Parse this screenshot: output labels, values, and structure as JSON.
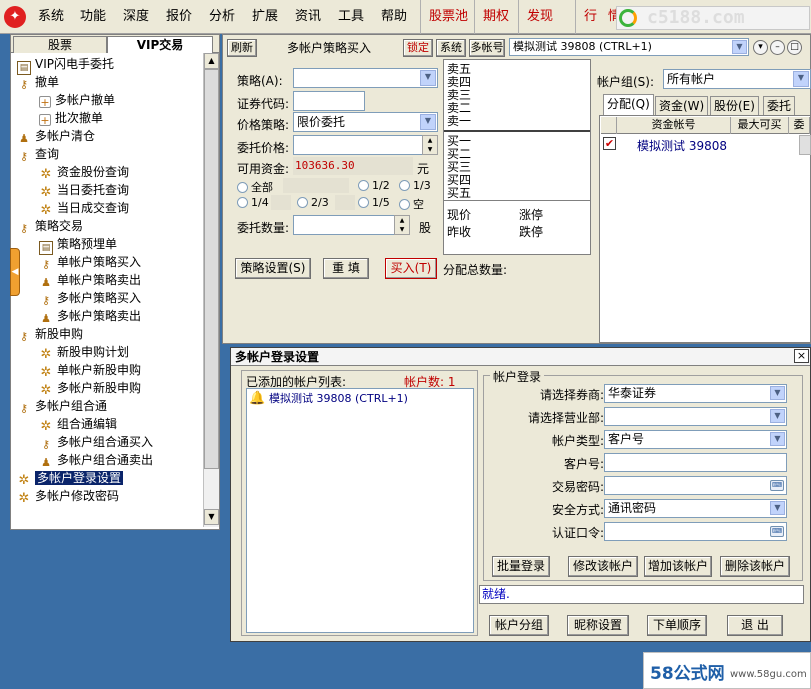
{
  "menubar": {
    "items": [
      "系统",
      "功能",
      "深度",
      "报价",
      "分析",
      "扩展",
      "资讯",
      "工具",
      "帮助"
    ],
    "red_items": [
      "股票池",
      "期权",
      "发现"
    ],
    "extra_items": [
      "行",
      "情"
    ],
    "brand": "c5188.com"
  },
  "left_panel": {
    "tabs": [
      "股票",
      "VIP交易"
    ],
    "tree": [
      {
        "label": "VIP闪电手委托",
        "icon": "book"
      },
      {
        "label": "撤单",
        "icon": "key"
      },
      {
        "label": "多帐户撤单",
        "icon": "plus"
      },
      {
        "label": "批次撤单",
        "icon": "plus"
      },
      {
        "label": "多帐户清仓",
        "icon": "person"
      },
      {
        "label": "查询",
        "icon": "key"
      },
      {
        "label": "资金股份查询",
        "icon": "gear"
      },
      {
        "label": "当日委托查询",
        "icon": "gear"
      },
      {
        "label": "当日成交查询",
        "icon": "gear"
      },
      {
        "label": "策略交易",
        "icon": "key"
      },
      {
        "label": "策略预埋单",
        "icon": "book"
      },
      {
        "label": "单帐户策略买入",
        "icon": "key"
      },
      {
        "label": "单帐户策略卖出",
        "icon": "person"
      },
      {
        "label": "多帐户策略买入",
        "icon": "key"
      },
      {
        "label": "多帐户策略卖出",
        "icon": "person"
      },
      {
        "label": "新股申购",
        "icon": "key"
      },
      {
        "label": "新股申购计划",
        "icon": "gear"
      },
      {
        "label": "单帐户新股申购",
        "icon": "gear"
      },
      {
        "label": "多帐户新股申购",
        "icon": "gear"
      },
      {
        "label": "多帐户组合通",
        "icon": "key"
      },
      {
        "label": "组合通编辑",
        "icon": "gear"
      },
      {
        "label": "多帐户组合通买入",
        "icon": "key"
      },
      {
        "label": "多帐户组合通卖出",
        "icon": "person"
      },
      {
        "label": "多帐户登录设置",
        "icon": "gear"
      },
      {
        "label": "多帐户修改密码",
        "icon": "gear"
      }
    ]
  },
  "main": {
    "refresh": "刷新",
    "title": "多帐户策略买入",
    "lock": "锁定",
    "system": "系统",
    "multi_account": "多帐号",
    "account_combo": "模拟测试 39808 (CTRL+1)",
    "labels": {
      "strategy": "策略(A):",
      "code": "证券代码:",
      "price_strategy": "价格策略:",
      "order_price": "委托价格:",
      "available": "可用资金:",
      "available_value": "103636.30",
      "yuan": "元",
      "quantity": "委托数量:",
      "shares": "股"
    },
    "price_strategy_value": "限价委托",
    "radios": [
      "全部",
      "1/2",
      "1/3",
      "1/4",
      "2/3",
      "1/5",
      "空"
    ],
    "buttons": {
      "settings": "策略设置(S)",
      "reset": "重 填",
      "buy": "买入(T)"
    },
    "alloc_total": "分配总数量:",
    "quotes": {
      "sells": [
        "卖五",
        "卖四",
        "卖三",
        "卖二",
        "卖一"
      ],
      "buys": [
        "买一",
        "买二",
        "买三",
        "买四",
        "买五"
      ],
      "current": "现价",
      "limit_up": "涨停",
      "prev_close": "昨收",
      "limit_down": "跌停"
    },
    "account_group_label": "帐户组(S):",
    "account_group_value": "所有帐户",
    "right_tabs": [
      "分配(Q)",
      "资金(W)",
      "股份(E)",
      "委托"
    ],
    "grid_headers": [
      "资金帐号",
      "最大可买",
      "委"
    ],
    "grid_row": "模拟测试  39808"
  },
  "dialog": {
    "title": "多帐户登录设置",
    "close": "×",
    "list_label": "已添加的帐户列表:",
    "count_label": "帐户数: 1",
    "accounts": [
      "模拟测试  39808 (CTRL+1)"
    ],
    "group_title": "帐户登录",
    "fields": [
      {
        "label": "请选择券商:",
        "value": "华泰证券",
        "type": "combo"
      },
      {
        "label": "请选择营业部:",
        "value": "",
        "type": "combo"
      },
      {
        "label": "帐户类型:",
        "value": "客户号",
        "type": "combo"
      },
      {
        "label": "客户号:",
        "value": "",
        "type": "text"
      },
      {
        "label": "交易密码:",
        "value": "",
        "type": "password"
      },
      {
        "label": "安全方式:",
        "value": "通讯密码",
        "type": "combo"
      },
      {
        "label": "认证口令:",
        "value": "",
        "type": "password"
      }
    ],
    "action_buttons": [
      "批量登录",
      "修改该帐户",
      "增加该帐户",
      "删除该帐户"
    ],
    "status": "就绪.",
    "bottom_buttons": [
      "帐户分组",
      "昵称设置",
      "下单顺序",
      "退 出"
    ]
  },
  "watermark": {
    "text1": "58公式网",
    "text2": "www.58gu.com"
  }
}
